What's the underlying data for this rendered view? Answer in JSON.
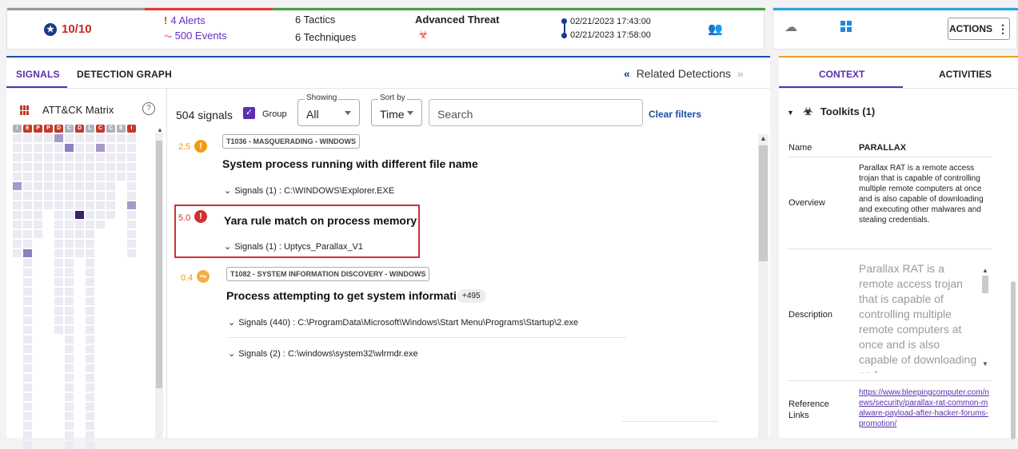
{
  "summary": {
    "score": "10/10",
    "alerts": "4 Alerts",
    "events": "500 Events",
    "tactics_num": "6",
    "tactics": "Tactics",
    "techniques_num": "6",
    "techniques": "Techniques",
    "threat": "Advanced Threat",
    "start_time": "02/21/2023 17:43:00",
    "end_time": "02/21/2023 17:58:00"
  },
  "actions_label": "ACTIONS",
  "tabs": {
    "signals": "SIGNALS",
    "graph": "DETECTION GRAPH"
  },
  "related": "Related Detections",
  "matrix": {
    "title": "ATT&CK Matrix",
    "headers": [
      "I",
      "E",
      "P",
      "P",
      "D",
      "C",
      "D",
      "L",
      "C",
      "C",
      "E",
      "I"
    ],
    "header_colors": [
      "#b0b0b8",
      "#c0392b",
      "#c0392b",
      "#c0392b",
      "#c0392b",
      "#b0b0b8",
      "#c0392b",
      "#b0b0b8",
      "#c0392b",
      "#b0b0b8",
      "#b0b0b8",
      "#c0392b"
    ]
  },
  "signals": {
    "count": "504 signals",
    "group_label": "Group",
    "showing_label": "Showing",
    "showing_value": "All",
    "sortby_label": "Sort by",
    "sortby_value": "Time",
    "search_placeholder": "Search",
    "clear_filters": "Clear filters",
    "items": [
      {
        "score": "2.5",
        "badge": "T1036 - MASQUERADING - WINDOWS",
        "title": "System process running with different file name",
        "signals": [
          "Signals (1) : C:\\WINDOWS\\Explorer.EXE"
        ]
      },
      {
        "score": "5.0",
        "badge": "",
        "title": "Yara rule match on process memory",
        "signals": [
          "Signals (1) : Uptycs_Parallax_V1"
        ]
      },
      {
        "score": "0.4",
        "badge": "T1082 - SYSTEM INFORMATION DISCOVERY - WINDOWS",
        "title": "Process attempting to get system information",
        "extra": "+495",
        "signals": [
          "Signals (440) : C:\\ProgramData\\Microsoft\\Windows\\Start Menu\\Programs\\Startup\\2.exe",
          "Signals (2) : C:\\windows\\system32\\wlrmdr.exe"
        ]
      }
    ]
  },
  "context": {
    "tab_context": "CONTEXT",
    "tab_activities": "ACTIVITIES",
    "section": "Toolkits (1)",
    "name_label": "Name",
    "name_value": "PARALLAX",
    "overview_label": "Overview",
    "overview_value": "Parallax RAT is a remote access trojan that is capable of controlling multiple remote computers at once and is also capable of downloading and executing other malwares and stealing credentials.",
    "description_label": "Description",
    "description_value": "Parallax RAT is a remote access trojan that is capable of controlling multiple remote computers at once and is also capable of downloading and",
    "ref_label": "Reference Links",
    "ref_value": "https://www.bleepingcomputer.com/news/security/parallax-rat-common-malware-payload-after-hacker-forums-promotion/"
  }
}
